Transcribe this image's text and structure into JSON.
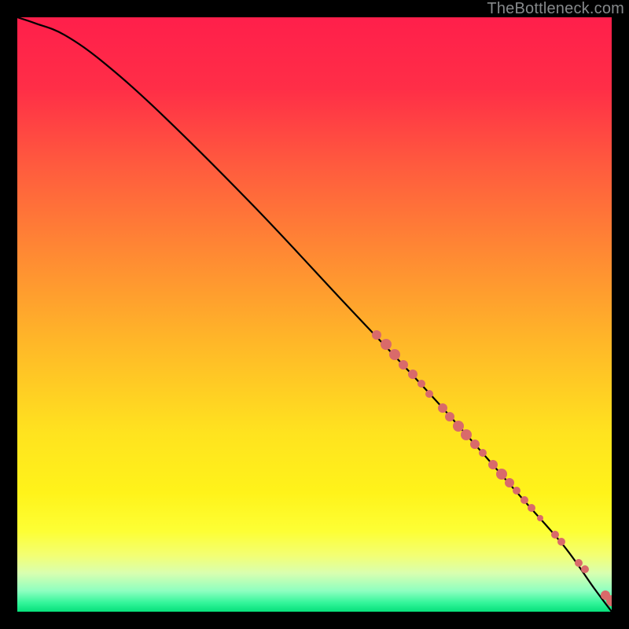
{
  "watermark": "TheBottleneck.com",
  "chart_data": {
    "type": "line",
    "title": "",
    "xlabel": "",
    "ylabel": "",
    "xlim": [
      0,
      100
    ],
    "ylim": [
      0,
      100
    ],
    "grid": false,
    "legend": false,
    "annotations": [],
    "gradient_stops": [
      {
        "offset": 0.0,
        "color": "#ff1f4b"
      },
      {
        "offset": 0.12,
        "color": "#ff2e47"
      },
      {
        "offset": 0.25,
        "color": "#ff5b3e"
      },
      {
        "offset": 0.4,
        "color": "#ff8a33"
      },
      {
        "offset": 0.55,
        "color": "#ffb828"
      },
      {
        "offset": 0.7,
        "color": "#ffe31f"
      },
      {
        "offset": 0.8,
        "color": "#fff31a"
      },
      {
        "offset": 0.865,
        "color": "#fdff35"
      },
      {
        "offset": 0.905,
        "color": "#f3ff73"
      },
      {
        "offset": 0.935,
        "color": "#d9ffb0"
      },
      {
        "offset": 0.965,
        "color": "#8effc0"
      },
      {
        "offset": 0.985,
        "color": "#33f59a"
      },
      {
        "offset": 1.0,
        "color": "#07e07b"
      }
    ],
    "series": [
      {
        "name": "curve",
        "x": [
          0,
          3,
          8,
          15,
          25,
          40,
          55,
          70,
          85,
          92,
          97,
          100
        ],
        "y": [
          100,
          99,
          97,
          92,
          83,
          68,
          52,
          36,
          19,
          11,
          4,
          0
        ],
        "stroke": "#000000",
        "stroke_width": 2.2
      }
    ],
    "scatter": {
      "name": "dots",
      "color": "#d96a6a",
      "points": [
        {
          "x": 60.5,
          "y": 46.5,
          "r": 6
        },
        {
          "x": 62.0,
          "y": 45.0,
          "r": 7
        },
        {
          "x": 63.5,
          "y": 43.3,
          "r": 7
        },
        {
          "x": 65.0,
          "y": 41.6,
          "r": 6
        },
        {
          "x": 66.5,
          "y": 40.0,
          "r": 6
        },
        {
          "x": 68.0,
          "y": 38.3,
          "r": 5
        },
        {
          "x": 69.3,
          "y": 36.7,
          "r": 5
        },
        {
          "x": 71.5,
          "y": 34.3,
          "r": 6
        },
        {
          "x": 72.8,
          "y": 32.8,
          "r": 6
        },
        {
          "x": 74.2,
          "y": 31.2,
          "r": 7
        },
        {
          "x": 75.5,
          "y": 29.8,
          "r": 7
        },
        {
          "x": 77.0,
          "y": 28.2,
          "r": 6
        },
        {
          "x": 78.3,
          "y": 26.7,
          "r": 5
        },
        {
          "x": 80.0,
          "y": 24.8,
          "r": 6
        },
        {
          "x": 81.5,
          "y": 23.2,
          "r": 7
        },
        {
          "x": 82.8,
          "y": 21.7,
          "r": 6
        },
        {
          "x": 84.0,
          "y": 20.4,
          "r": 5
        },
        {
          "x": 85.3,
          "y": 18.8,
          "r": 5
        },
        {
          "x": 86.5,
          "y": 17.4,
          "r": 5
        },
        {
          "x": 88.0,
          "y": 15.8,
          "r": 4
        },
        {
          "x": 90.5,
          "y": 13.0,
          "r": 5
        },
        {
          "x": 91.5,
          "y": 11.8,
          "r": 5
        },
        {
          "x": 94.5,
          "y": 8.2,
          "r": 5
        },
        {
          "x": 95.5,
          "y": 7.2,
          "r": 5
        },
        {
          "x": 99.0,
          "y": 2.8,
          "r": 6
        },
        {
          "x": 100.0,
          "y": 1.8,
          "r": 7
        },
        {
          "x": 101.0,
          "y": 1.2,
          "r": 6
        }
      ]
    }
  }
}
